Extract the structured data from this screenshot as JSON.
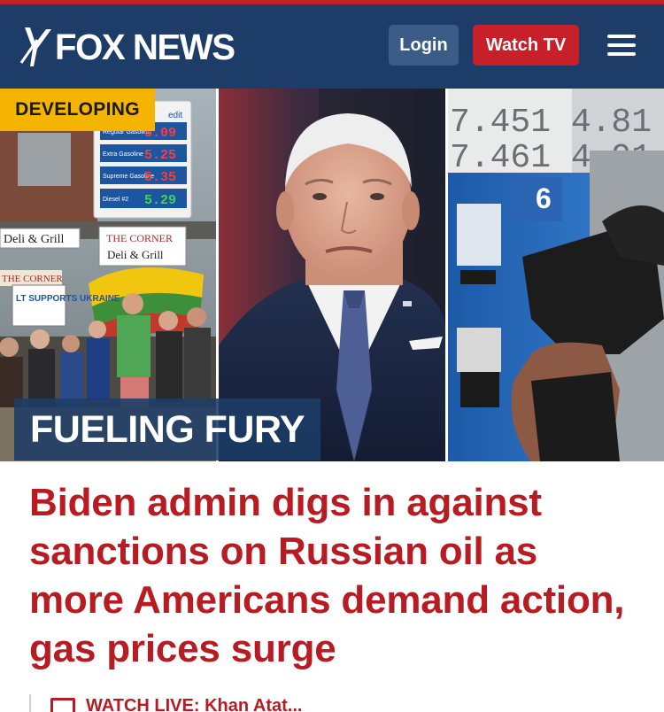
{
  "header": {
    "logo_text": "FOX NEWS",
    "login_label": "Login",
    "watch_label": "Watch TV",
    "menu_icon": "hamburger-icon",
    "colors": {
      "bar": "#1d3c68",
      "accent_red": "#c8202a",
      "login_bg": "#3a5c86"
    }
  },
  "hero": {
    "badge": "DEVELOPING",
    "kicker": "FUELING FURY",
    "left_panel": {
      "price_rows": [
        {
          "label": "Regular Gasoline",
          "price": "5.09"
        },
        {
          "label": "Extra Gasoline",
          "price": "5.25"
        },
        {
          "label": "Supreme Gasoline",
          "price": "5.35"
        },
        {
          "label": "Diesel #2",
          "price": "5.29"
        }
      ],
      "sign_top": "edit",
      "store_sign_1": "Deli & Grill",
      "store_sign_2_line1": "THE CORNER",
      "store_sign_2_line2": "Deli & Grill",
      "store_sign_3": "THE CORNER",
      "protest_sign": "LT SUPPORTS UKRAINE"
    },
    "right_panel": {
      "pump_price_1": "7.451 4.81",
      "pump_price_2": "7.461 4.91",
      "pump_number": "6"
    }
  },
  "article": {
    "headline": "Biden admin digs in against sanctions on Russian oil as more Americans demand action, gas prices surge",
    "watch_live_partial": "WATCH LIVE: Khan Atat..."
  }
}
